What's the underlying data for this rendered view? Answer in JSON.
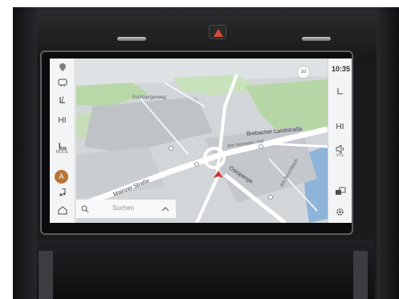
{
  "status": {
    "time": "10:35"
  },
  "left_rail": {
    "climate_left": "HI",
    "mode_label": "MODE",
    "auto_label": "A"
  },
  "right_rail": {
    "climate_right": "HI",
    "vol_label": "VOL"
  },
  "map": {
    "compass": "3D",
    "labels": {
      "area": "Eschbergerweg",
      "road_main": "Brebacher Landstraße",
      "road_small": "Am Nonnenkeitel",
      "road_south": "Mainzer Straße",
      "ostspange": "Ostspange",
      "am_bruch": "Am Bruchbach"
    }
  },
  "search": {
    "placeholder": "Suchen"
  },
  "icons": {
    "hazard": "hazard-warning-icon",
    "search": "search-icon",
    "chevron": "chevron-up-icon",
    "home": "home-icon",
    "music": "music-note-icon",
    "seat": "seat-icon",
    "defrost": "defrost-icon",
    "heater": "seat-heater-icon",
    "volume": "volume-icon",
    "settings": "settings-gear-icon",
    "screens": "screen-switch-icon",
    "vehicle": "vehicle-position-icon"
  }
}
